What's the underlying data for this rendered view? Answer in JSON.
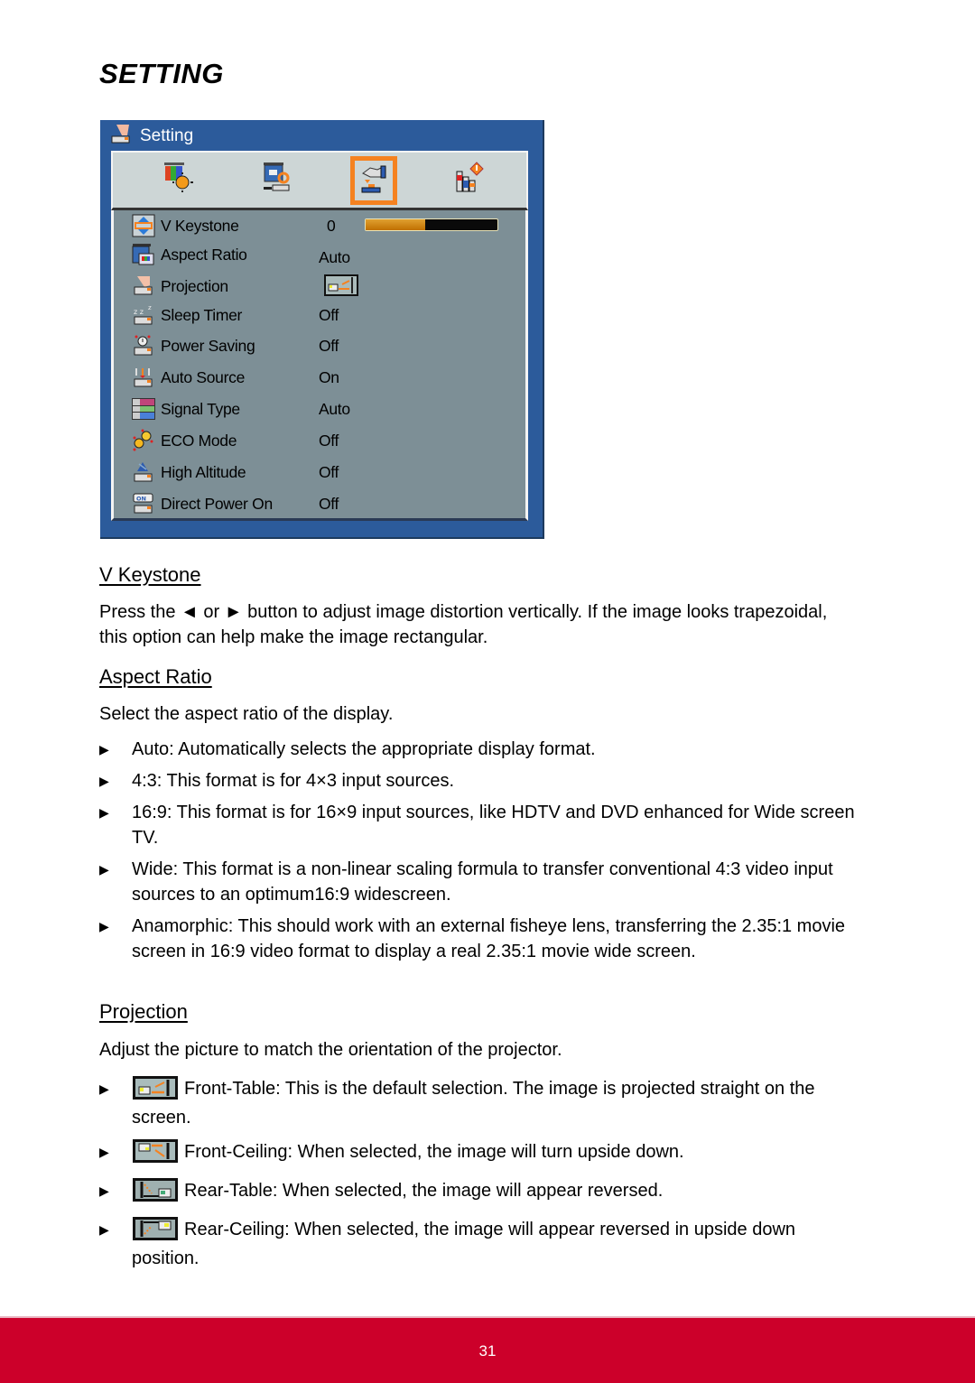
{
  "page": {
    "title": "SETTING",
    "page_number": "31",
    "footer_color": "#cc002a"
  },
  "osd": {
    "header_label": "Setting",
    "header_icon": "projector-setting-icon",
    "tabs": [
      {
        "icon": "picture-icon",
        "selected": false
      },
      {
        "icon": "screen-icon",
        "selected": false
      },
      {
        "icon": "setting-icon",
        "selected": true
      },
      {
        "icon": "options-icon",
        "selected": false
      }
    ],
    "items": [
      {
        "icon": "v-keystone-icon",
        "name": "V Keystone",
        "value": "0",
        "slider_fraction": 0.45
      },
      {
        "icon": "aspect-ratio-icon",
        "name": "Aspect Ratio",
        "value": "Auto"
      },
      {
        "icon": "projection-icon",
        "name": "Projection",
        "value_icon": "front-table-icon"
      },
      {
        "icon": "sleep-timer-icon",
        "name": "Sleep Timer",
        "value": "Off"
      },
      {
        "icon": "power-saving-icon",
        "name": "Power Saving",
        "value": "Off"
      },
      {
        "icon": "auto-source-icon",
        "name": "Auto Source",
        "value": "On"
      },
      {
        "icon": "signal-type-icon",
        "name": "Signal Type",
        "value": "Auto"
      },
      {
        "icon": "eco-mode-icon",
        "name": "ECO Mode",
        "value": "Off"
      },
      {
        "icon": "high-altitude-icon",
        "name": "High Altitude",
        "value": "Off"
      },
      {
        "icon": "direct-power-on-icon",
        "name": "Direct Power On",
        "value": "Off"
      }
    ]
  },
  "sections": {
    "vkeystone": {
      "heading": "V Keystone",
      "body": "Press the ◄ or ► button to adjust image distortion vertically. If the image looks trapezoidal, this option can help make the image rectangular."
    },
    "aspect": {
      "heading": "Aspect Ratio",
      "intro": "Select the aspect ratio of the display.",
      "bullets": [
        "Auto: Automatically selects the appropriate display format.",
        "4:3: This format is for 4×3 input sources.",
        "16:9: This format is for 16×9 input sources, like HDTV and DVD enhanced for Wide screen TV.",
        "Wide: This format is a non-linear scaling formula to transfer conventional 4:3 video input sources  to an optimum16:9 widescreen.",
        "Anamorphic: This should work with an external fisheye lens, transferring the 2.35:1 movie screen in 16:9 video format to display a real 2.35:1 movie wide screen."
      ]
    },
    "projection": {
      "heading": "Projection",
      "intro": "Adjust the picture to match the orientation of the projector.",
      "bullets": [
        {
          "icon": "front-table-icon",
          "text": "Front-Table: This is the default selection. The image is projected straight on the screen."
        },
        {
          "icon": "front-ceiling-icon",
          "text": "Front-Ceiling: When selected, the image will turn upside down."
        },
        {
          "icon": "rear-table-icon",
          "text": "Rear-Table: When selected, the image will appear reversed."
        },
        {
          "icon": "rear-ceiling-icon",
          "text": "Rear-Ceiling: When selected, the image will appear reversed in upside down position."
        }
      ]
    },
    "bullet_glyph": "▶"
  }
}
